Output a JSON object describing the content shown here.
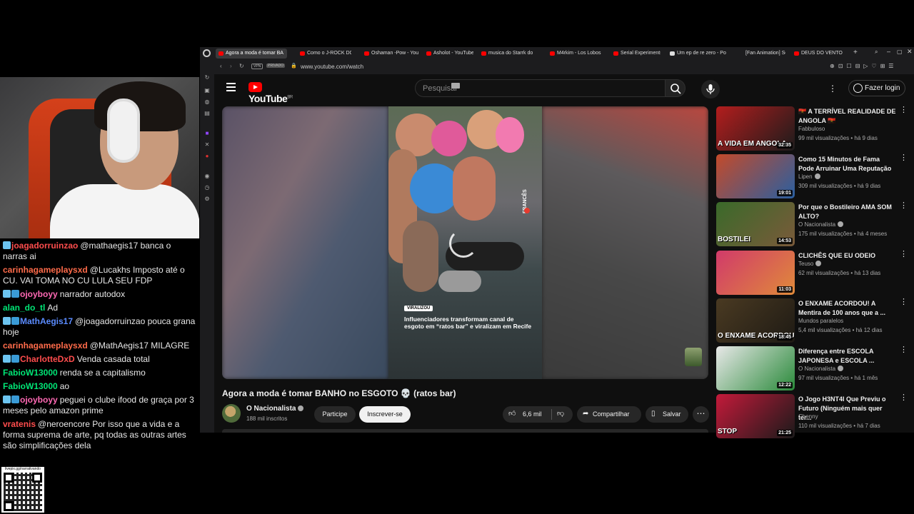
{
  "chat": [
    {
      "badges": [
        "b1"
      ],
      "user": "joagadorruinzao",
      "color": "#ff4d4d",
      "text": "@mathaegis17 banca o narras ai"
    },
    {
      "badges": [],
      "user": "carinhagameplaysxd",
      "color": "#ff6b4a",
      "text": "@Lucakhs Imposto até o CU. VAI TOMA NO CU LULA SEU FDP"
    },
    {
      "badges": [
        "b1",
        "b2"
      ],
      "user": "ojoyboyy",
      "color": "#ff69b4",
      "text": "narrador autodox"
    },
    {
      "badges": [],
      "user": "alan_do_tl",
      "color": "#00e676",
      "text": "Ad"
    },
    {
      "badges": [
        "b1",
        "b2"
      ],
      "user": "MathAegis17",
      "color": "#5b8cff",
      "text": "@joagadorruinzao pouca grana hoje"
    },
    {
      "badges": [],
      "user": "carinhagameplaysxd",
      "color": "#ff6b4a",
      "text": "@MathAegis17 MILAGRE"
    },
    {
      "badges": [
        "b1",
        "b2"
      ],
      "user": "CharlotteDxD",
      "color": "#ff4d4d",
      "text": "Venda casada total"
    },
    {
      "badges": [],
      "user": "FabioW13000",
      "color": "#00e676",
      "text": "renda se a capitalismo"
    },
    {
      "badges": [],
      "user": "FabioW13000",
      "color": "#00e676",
      "text": "ao"
    },
    {
      "badges": [
        "b1",
        "b2"
      ],
      "user": "ojoyboyy",
      "color": "#ff69b4",
      "text": "peguei o clube ifood de graça por 3 meses pelo amazon prime"
    },
    {
      "badges": [],
      "user": "vratenis",
      "color": "#ff4d4d",
      "text": "@neroencore Por isso que a vida e a forma suprema de arte, pq todas as outras artes são simplificações dela"
    }
  ],
  "qr_label": "livepix.gg/narrativando",
  "browser": {
    "tabs": [
      {
        "label": "Agora a moda é tomar BA",
        "active": true
      },
      {
        "label": "Como o J-ROCK DOM",
        "active": false
      },
      {
        "label": "Oshaman -Pow - You",
        "active": false
      },
      {
        "label": "Asholot - YouTube",
        "active": false
      },
      {
        "label": "musica do Starrk do",
        "active": false
      },
      {
        "label": "M4rkim - Los Lobos",
        "active": false
      },
      {
        "label": "Serial Experiments La",
        "active": false
      },
      {
        "label": "Um ep de re zero - Po",
        "active": false
      },
      {
        "label": "[Fan Animation] Son",
        "active": false
      },
      {
        "label": "DEUS DO VENTO (Mo",
        "active": false
      }
    ],
    "vpn_label": "VPN",
    "private_label": "PRIVADO",
    "url": "www.youtube.com/watch"
  },
  "youtube": {
    "logo_text": "YouTube",
    "region": "BR",
    "search_placeholder": "Pesquisar",
    "login_label": "Fazer login",
    "video": {
      "badge": "VIRALIZOU",
      "caption": "Influenciadores transformam canal de esgoto em “ratos bar” e viralizam em Recife",
      "side_label": "FRANCÊS",
      "title": "Agora a moda é tomar BANHO no ESGOTO 💀 (ratos bar)",
      "channel": "O Nacionalista",
      "subscribers": "188 mil inscritos",
      "join_label": "Participe",
      "subscribe_label": "Inscrever-se",
      "likes": "6,6 mil",
      "share_label": "Compartilhar",
      "save_label": "Salvar"
    },
    "recommendations": [
      {
        "title": "🇦🇴 A TERRÍVEL REALIDADE DE ANGOLA 🇦🇴",
        "channel": "Fabbuloso",
        "verified": false,
        "meta": "99 mil visualizações • há 9 dias",
        "duration": "32:35",
        "thumb_text": "A VIDA EM ANGOLA",
        "c1": "#b31d1d",
        "c2": "#1c1c1c"
      },
      {
        "title": "Como 15 Minutos de Fama Pode Arruinar Uma Reputação",
        "channel": "Lipen",
        "verified": true,
        "meta": "309 mil visualizações • há 9 dias",
        "duration": "19:01",
        "thumb_text": "",
        "c1": "#c44a2a",
        "c2": "#2a5fa0"
      },
      {
        "title": "Por que o Bostileiro AMA SOM ALTO?",
        "channel": "O Nacionalista",
        "verified": true,
        "meta": "175 mil visualizações • há 4 meses",
        "duration": "14:53",
        "thumb_text": "BOSTILEI",
        "c1": "#3a6a2a",
        "c2": "#7a5a3a"
      },
      {
        "title": "CLICHÊS QUE EU ODEIO",
        "channel": "Teuso",
        "verified": true,
        "meta": "62 mil visualizações • há 13 dias",
        "duration": "11:03",
        "thumb_text": "",
        "c1": "#d13a6a",
        "c2": "#e08a3a"
      },
      {
        "title": "O ENXAME ACORDOU! A Mentira de 100 anos que a ...",
        "channel": "Mundos paralelos",
        "verified": false,
        "meta": "5,4 mil visualizações • há 12 dias",
        "duration": "18:45",
        "thumb_text": "O ENXAME ACORDOU",
        "c1": "#4a3a22",
        "c2": "#1e1a14"
      },
      {
        "title": "Diferença entre ESCOLA JAPONESA e ESCOLA ...",
        "channel": "O Nacionalista",
        "verified": true,
        "meta": "97 mil visualizações • há 1 mês",
        "duration": "12:22",
        "thumb_text": "",
        "c1": "#e8e8e8",
        "c2": "#2a8a3a"
      },
      {
        "title": "O Jogo H3NT4I Que Previu o Futuro (Ninguém mais quer ter...",
        "channel": "Chenny",
        "verified": false,
        "meta": "110 mil visualizações • há 7 dias",
        "duration": "21:25",
        "thumb_text": "STOP",
        "c1": "#c41a3a",
        "c2": "#1a1a1a"
      }
    ]
  }
}
